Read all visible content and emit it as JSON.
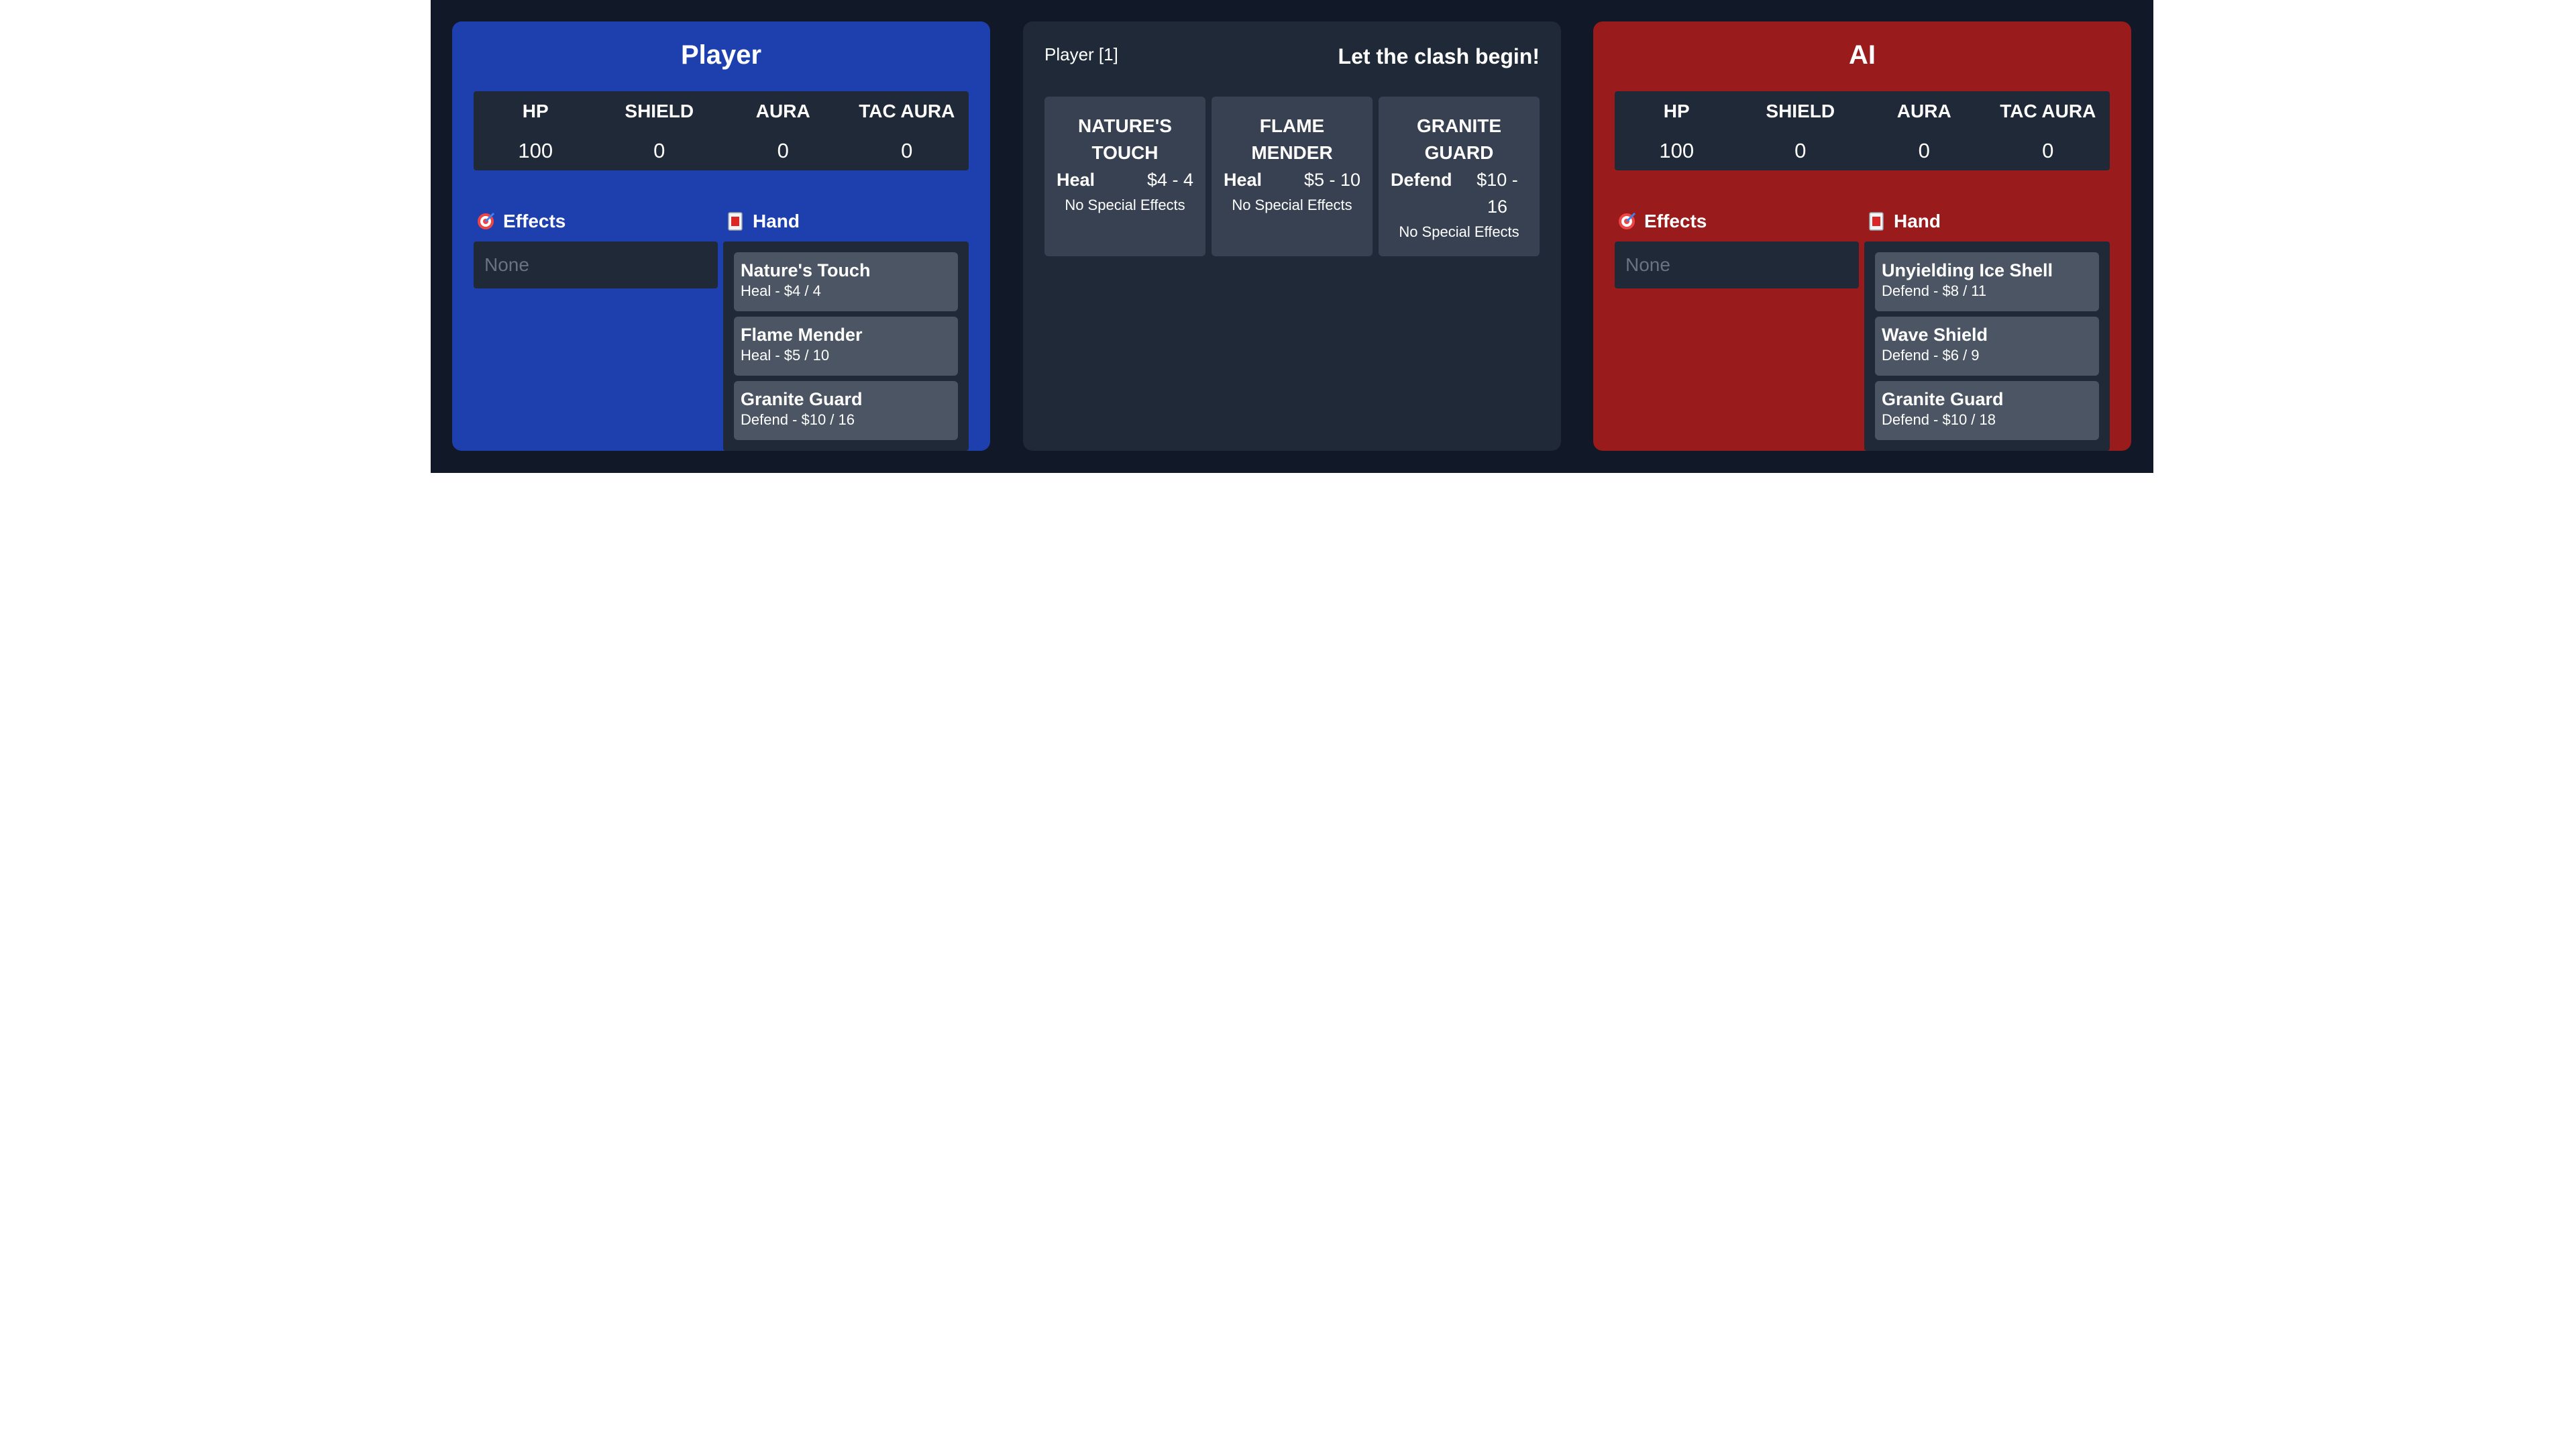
{
  "player": {
    "title": "Player",
    "stats": {
      "headers": [
        "HP",
        "SHIELD",
        "AURA",
        "TAC AURA"
      ],
      "values": [
        "100",
        "0",
        "0",
        "0"
      ]
    },
    "effects_label": "Effects",
    "effects_value": "None",
    "hand_label": "Hand",
    "hand": [
      {
        "name": "Nature's Touch",
        "desc": "Heal - $4 / 4"
      },
      {
        "name": "Flame Mender",
        "desc": "Heal - $5 / 10"
      },
      {
        "name": "Granite Guard",
        "desc": "Defend - $10 / 16"
      }
    ]
  },
  "center": {
    "turn_label": "Player [1]",
    "message": "Let the clash begin!",
    "cards": [
      {
        "name": "Nature's Touch",
        "type": "Heal",
        "range": "$4 - 4",
        "special": "No Special Effects"
      },
      {
        "name": "Flame Mender",
        "type": "Heal",
        "range": "$5 - 10",
        "special": "No Special Effects"
      },
      {
        "name": "Granite Guard",
        "type": "Defend",
        "range": "$10 - 16",
        "special": "No Special Effects"
      }
    ]
  },
  "ai": {
    "title": "AI",
    "stats": {
      "headers": [
        "HP",
        "SHIELD",
        "AURA",
        "TAC AURA"
      ],
      "values": [
        "100",
        "0",
        "0",
        "0"
      ]
    },
    "effects_label": "Effects",
    "effects_value": "None",
    "hand_label": "Hand",
    "hand": [
      {
        "name": "Unyielding Ice Shell",
        "desc": "Defend - $8 / 11"
      },
      {
        "name": "Wave Shield",
        "desc": "Defend - $6 / 9"
      },
      {
        "name": "Granite Guard",
        "desc": "Defend - $10 / 18"
      }
    ]
  },
  "icons": {
    "effects": "target-icon",
    "hand": "card-icon"
  },
  "colors": {
    "frame_bg": "#111827",
    "player_panel": "#1e40af",
    "ai_panel": "#991b1b",
    "center_panel": "#1f2937",
    "card_bg": "#4b5563"
  }
}
